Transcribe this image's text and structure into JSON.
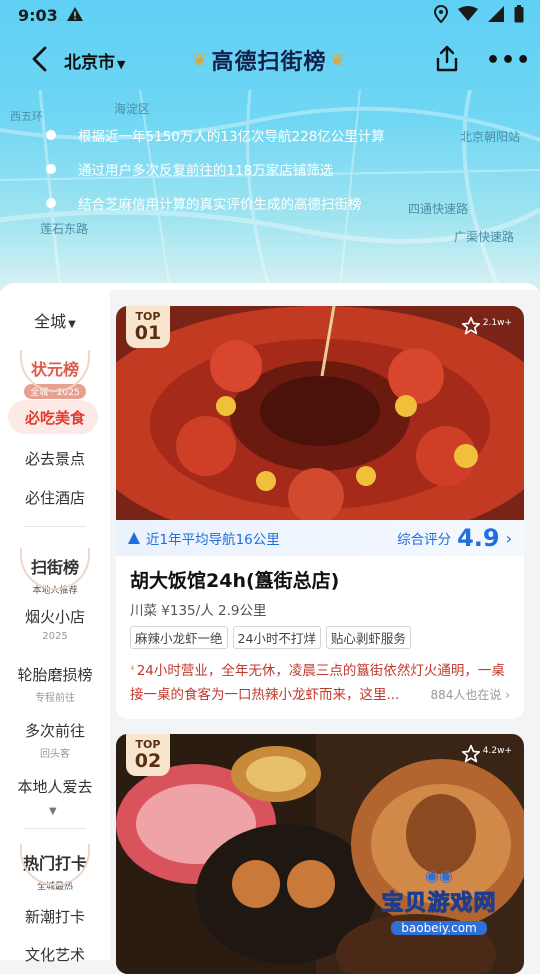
{
  "status_bar": {
    "time": "9:03"
  },
  "header": {
    "city": "北京市",
    "title": "高德扫街榜",
    "bullets": [
      "根据近一年5150万人的13亿次导航228亿公里计算",
      "通过用户多次反复前往的118万家店铺筛选",
      "结合芝麻信用计算的真实评价生成的高德扫街榜"
    ],
    "map_labels": [
      "海淀区",
      "北京朝阳站",
      "西五环",
      "莲石东路",
      "广渠快速路",
      "四通快速路"
    ]
  },
  "sidebar": {
    "scope": "全城",
    "sections": [
      {
        "title": "状元榜",
        "subtitle": "全城 · 2025",
        "color": "#e05a4a",
        "items": [
          {
            "label": "必吃美食",
            "active": true
          },
          {
            "label": "必去景点"
          },
          {
            "label": "必住酒店"
          }
        ]
      },
      {
        "title": "扫街榜",
        "subtitle": "本地人推荐",
        "color": "#444444",
        "items": [
          {
            "label": "烟火小店",
            "sub": "2025"
          },
          {
            "label": "轮胎磨损榜",
            "sub": "专程前往"
          },
          {
            "label": "多次前往",
            "sub": "回头客"
          },
          {
            "label": "本地人爱去"
          }
        ]
      },
      {
        "title": "热门打卡",
        "subtitle": "全城最热",
        "color": "#444444",
        "items": [
          {
            "label": "新潮打卡"
          },
          {
            "label": "文化艺术"
          }
        ]
      }
    ]
  },
  "cards": [
    {
      "rank_label": "TOP",
      "rank": "01",
      "fav_count": "2.1w+",
      "nav_text": "近1年平均导航16公里",
      "score_label": "综合评分",
      "score": "4.9",
      "name": "胡大饭馆24h(簋街总店)",
      "meta": "川菜 ¥135/人  2.9公里",
      "tags": [
        "麻辣小龙虾一绝",
        "24小时不打烊",
        "贴心剥虾服务"
      ],
      "desc": "24小时营业，全年无休，凌晨三点的簋街依然灯火通明，一桌接一桌的食客为一口热辣小龙虾而来，这里...",
      "said": "884人也在说"
    },
    {
      "rank_label": "TOP",
      "rank": "02",
      "fav_count": "4.2w+"
    }
  ],
  "watermark": {
    "line1": "宝贝游戏网",
    "line2": "baobeiy.com"
  }
}
